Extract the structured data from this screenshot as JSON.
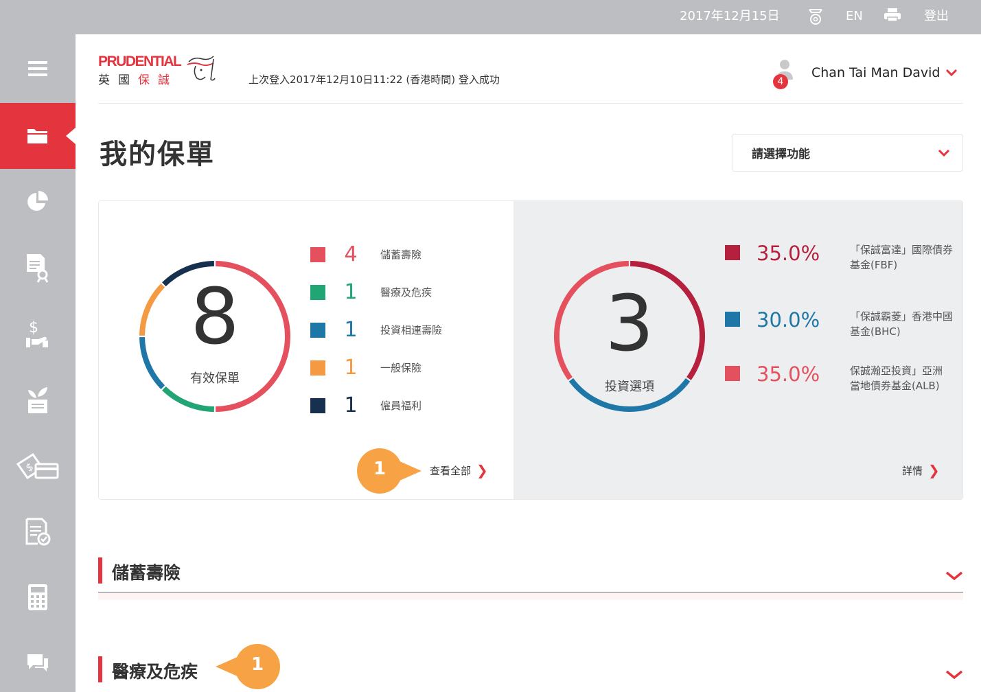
{
  "topbar": {
    "date": "2017年12月15日",
    "lang": "EN",
    "logout": "登出",
    "mail_icon": "mail-at-icon",
    "print_icon": "printer-icon"
  },
  "sidebar": {
    "items": [
      {
        "name": "menu",
        "icon": "hamburger-icon",
        "active": false
      },
      {
        "name": "my-policies",
        "icon": "folder-icon",
        "active": true
      },
      {
        "name": "portfolio",
        "icon": "pie-chart-icon",
        "active": false
      },
      {
        "name": "claims",
        "icon": "document-search-icon",
        "active": false
      },
      {
        "name": "payment",
        "icon": "dollar-hand-icon",
        "active": false
      },
      {
        "name": "growth",
        "icon": "plant-document-icon",
        "active": false
      },
      {
        "name": "cash-card",
        "icon": "money-card-icon",
        "active": false
      },
      {
        "name": "forms",
        "icon": "document-check-icon",
        "active": false
      },
      {
        "name": "calculator",
        "icon": "calculator-icon",
        "active": false
      },
      {
        "name": "chat",
        "icon": "chat-icon",
        "active": false
      }
    ]
  },
  "header": {
    "logo_top": "PRUDENTIAL",
    "logo_cn_1": "英",
    "logo_cn_2": "國",
    "logo_cn_3": "保",
    "logo_cn_4": "誠",
    "last_login": "上次登入2017年12月10日11:22 (香港時間) 登入成功",
    "user_name": "Chan Tai Man David",
    "notifications": "4"
  },
  "page": {
    "title": "我的保單",
    "function_select": "請選擇功能"
  },
  "policies": {
    "total": "8",
    "total_label": "有效保單",
    "view_all": "查看全部",
    "items": [
      {
        "count": "4",
        "label": "儲蓄壽險",
        "color": "#e5505f"
      },
      {
        "count": "1",
        "label": "醫療及危疾",
        "color": "#22a574"
      },
      {
        "count": "1",
        "label": "投資相連壽險",
        "color": "#1f77a8"
      },
      {
        "count": "1",
        "label": "一般保險",
        "color": "#f39a43"
      },
      {
        "count": "1",
        "label": "僱員福利",
        "color": "#17304f"
      }
    ]
  },
  "investments": {
    "total": "3",
    "total_label": "投資選項",
    "details": "詳情",
    "funds": [
      {
        "pct": "35.0%",
        "name_1": "「保誠富達」國際債券",
        "name_2": "基金(FBF)",
        "color": "#b5203f"
      },
      {
        "pct": "30.0%",
        "name_1": "「保誠霸菱」香港中國",
        "name_2": "基金(BHC)",
        "color": "#1f77a8"
      },
      {
        "pct": "35.0%",
        "name_1": "保誠瀚亞投資」亞洲",
        "name_2": "當地債券基金(ALB)",
        "color": "#e5505f"
      }
    ]
  },
  "callouts": {
    "view_all": "1",
    "section": "1",
    "color": "#f7a345"
  },
  "sections": [
    {
      "title": "儲蓄壽險"
    },
    {
      "title": "醫療及危疾"
    }
  ],
  "accent": "#e4343e"
}
